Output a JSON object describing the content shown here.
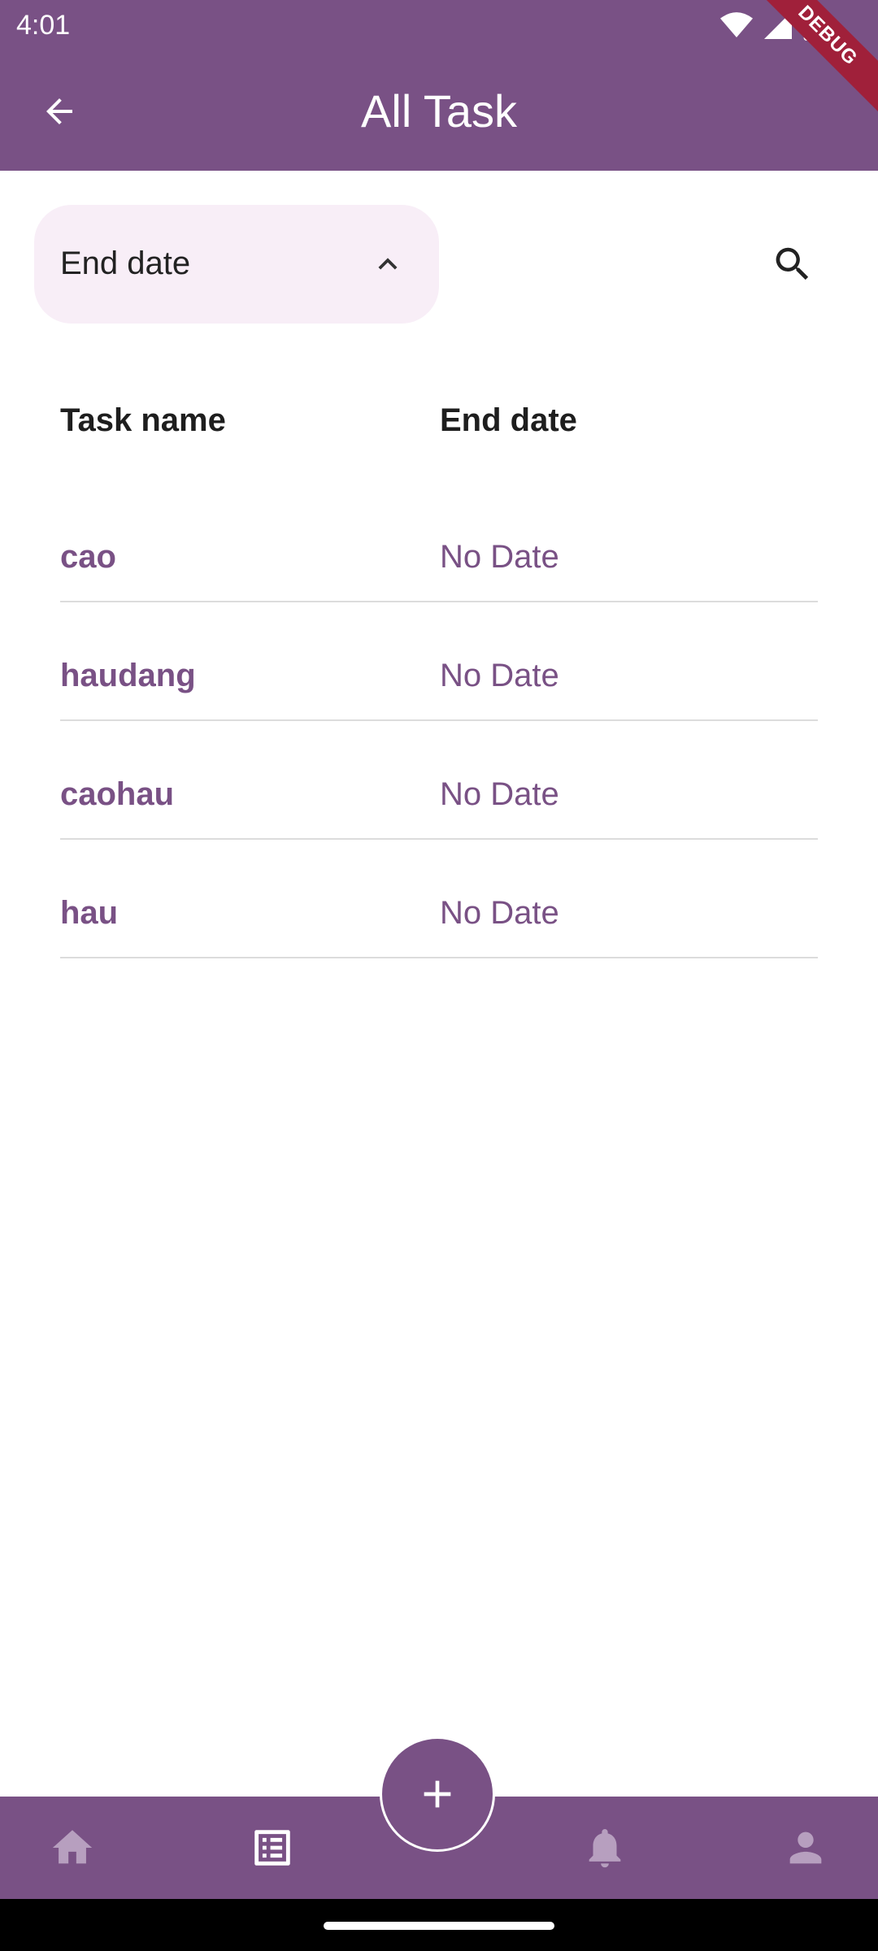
{
  "status_bar": {
    "time": "4:01"
  },
  "app_bar": {
    "title": "All Task",
    "debug_banner": "DEBUG"
  },
  "sort_dropdown": {
    "selected": "End date"
  },
  "table": {
    "headers": [
      "Task name",
      "End date"
    ],
    "rows": [
      {
        "name": "cao",
        "end_date": "No Date"
      },
      {
        "name": "haudang",
        "end_date": "No Date"
      },
      {
        "name": "caohau",
        "end_date": "No Date"
      },
      {
        "name": "hau",
        "end_date": "No Date"
      }
    ]
  },
  "bottom_nav": {
    "items": [
      "home-icon",
      "list-icon",
      "add-icon",
      "bell-icon",
      "person-icon"
    ],
    "active": "list-icon"
  },
  "colors": {
    "primary": "#795185",
    "chip_bg": "#f8eef7",
    "text": "#1e1e1e",
    "inactive_icon": "#b79fbf",
    "debug_ribbon": "#a0203a"
  }
}
